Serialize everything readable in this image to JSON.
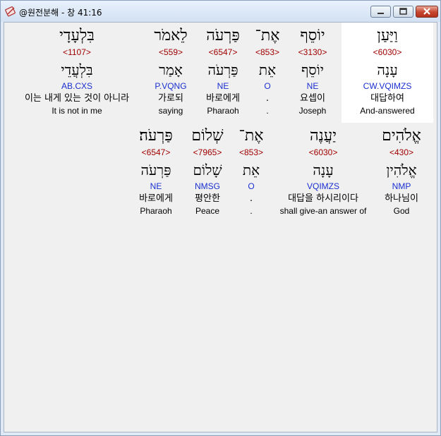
{
  "window": {
    "title": "@원전분해 - 창 41:16"
  },
  "verse": {
    "line1": [
      {
        "hebrew": "וַיַּעַן",
        "strong": "<6030>",
        "lemma": "עָנָה",
        "parsing": "CW.VQIMZS",
        "korean": "대답하여",
        "english": "And-answered"
      },
      {
        "hebrew": "יוֹסֵף",
        "strong": "<3130>",
        "lemma": "יוֹסֵף",
        "parsing": "NE",
        "korean": "요셉이",
        "english": "Joseph"
      },
      {
        "hebrew": "אֶת־",
        "strong": "<853>",
        "lemma": "אֵת",
        "parsing": "O",
        "korean": ".",
        "english": "."
      },
      {
        "hebrew": "פַּרְעֹה",
        "strong": "<6547>",
        "lemma": "פַּרְעֹה",
        "parsing": "NE",
        "korean": "바로에게",
        "english": "Pharaoh"
      },
      {
        "hebrew": "לֵאמֹר",
        "strong": "<559>",
        "lemma": "אָמַר",
        "parsing": "P.VQNG",
        "korean": "가로되",
        "english": "saying"
      },
      {
        "hebrew": "בִּלְעָדָי",
        "strong": "<1107>",
        "lemma": "בִּלְעֲדֵי",
        "parsing": "AB.CXS",
        "korean": "이는 내게 있는 것이 아니라",
        "english": "It is not in me"
      }
    ],
    "line2": [
      {
        "hebrew": "אֱלֹהִים",
        "strong": "<430>",
        "lemma": "אֱלֹהִין",
        "parsing": "NMP",
        "korean": "하나님이",
        "english": "God"
      },
      {
        "hebrew": "יַעֲנֶה",
        "strong": "<6030>",
        "lemma": "עָנָה",
        "parsing": "VQIMZS",
        "korean": "대답을 하시리이다",
        "english": "shall give-an answer of"
      },
      {
        "hebrew": "אֶת־",
        "strong": "<853>",
        "lemma": "אֵת",
        "parsing": "O",
        "korean": ".",
        "english": "."
      },
      {
        "hebrew": "שְׁלוֹם",
        "strong": "<7965>",
        "lemma": "שָׁלוֹם",
        "parsing": "NMSG",
        "korean": "평안한",
        "english": "Peace"
      },
      {
        "hebrew": "פַּרְעֹה׃",
        "strong": "<6547>",
        "lemma": "פַּרְעֹה",
        "parsing": "NE",
        "korean": "바로에게",
        "english": "Pharaoh"
      }
    ]
  },
  "colors": {
    "strong": "#a00000",
    "parsing": "#1a2fd0",
    "selection": "#ffffff"
  },
  "icons": {
    "app": "book-pen-icon",
    "minimize": "minimize-icon",
    "maximize": "maximize-icon",
    "close": "close-icon"
  }
}
